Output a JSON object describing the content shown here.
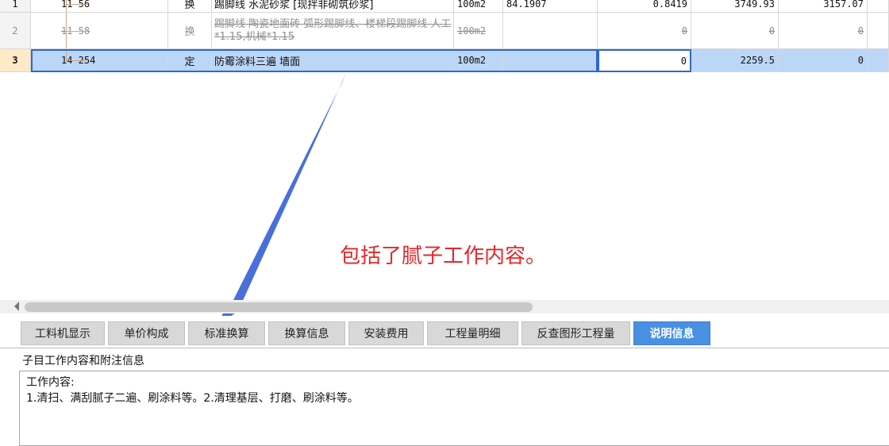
{
  "rows": [
    {
      "index": "1",
      "code": "11-56",
      "type": "换",
      "name": "踢脚线 水泥砂浆 [现拌非砌筑砂浆]",
      "unit": "100m2",
      "qty": "84.1907",
      "a": "0.8419",
      "b": "3749.93",
      "c": "3157.07"
    },
    {
      "index": "2",
      "code": "11-58",
      "type": "换",
      "name": "踢脚线 陶瓷地面砖 弧形踢脚线、楼梯段踢脚线 人工*1.15,机械*1.15",
      "unit": "100m2",
      "qty": "",
      "a": "0",
      "b": "0",
      "c": "0"
    },
    {
      "index": "3",
      "code": "14-254",
      "type": "定",
      "name": "防霉涂料三遍 墙面",
      "unit": "100m2",
      "qty": "",
      "a": "0",
      "b": "2259.5",
      "c": "0"
    }
  ],
  "annotation": {
    "text": "包括了腻子工作内容。",
    "color": "#e8262a"
  },
  "tabs": [
    {
      "label": "工料机显示"
    },
    {
      "label": "单价构成"
    },
    {
      "label": "标准换算"
    },
    {
      "label": "换算信息"
    },
    {
      "label": "安装费用"
    },
    {
      "label": "工程量明细"
    },
    {
      "label": "反查图形工程量"
    },
    {
      "label": "说明信息"
    }
  ],
  "active_tab": "说明信息",
  "panel": {
    "title": "子目工作内容和附注信息",
    "work_title": "工作内容:",
    "work_prefix": "1.清扫、",
    "work_highlight": "满刮腻子二遍",
    "work_suffix": "、刷涂料等。2.清理基层、打磨、刷涂料等。"
  },
  "colors": {
    "accent": "#4a90e2",
    "selection": "#bcd6f7",
    "markup": "#e8262a",
    "arrow": "#3a63d8"
  }
}
